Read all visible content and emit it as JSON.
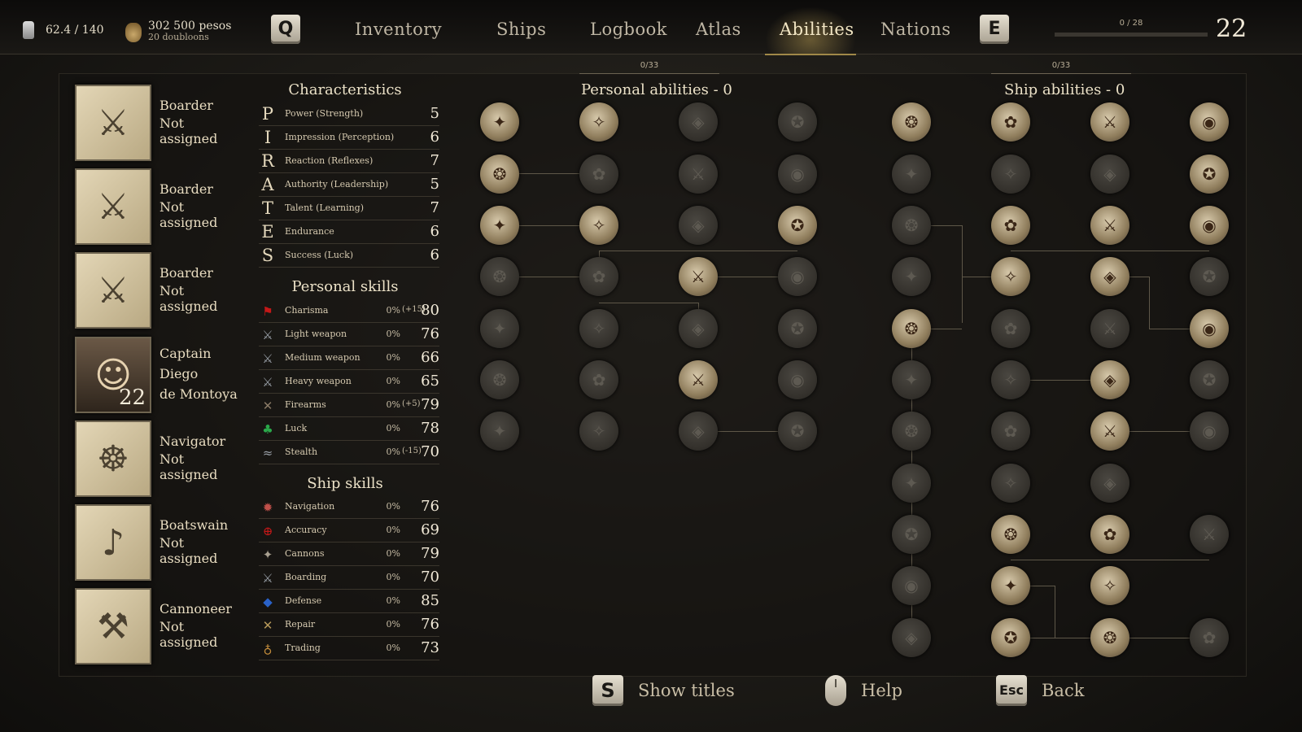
{
  "topbar": {
    "weight": "62.4 / 140",
    "pesos": "302 500 pesos",
    "doubloons": "20 doubloons",
    "key_left": "Q",
    "key_right": "E",
    "tabs": [
      "Inventory",
      "Ships",
      "Logbook",
      "Atlas",
      "Abilities",
      "Nations"
    ],
    "active_tab": "Abilities",
    "xp": "0 / 28",
    "xp_fraction": 0,
    "level": "22"
  },
  "officers": [
    {
      "role": "Boarder",
      "status": "Not assigned",
      "icon": "crossed-swords-icon"
    },
    {
      "role": "Boarder",
      "status": "Not assigned",
      "icon": "crossed-swords-icon"
    },
    {
      "role": "Boarder",
      "status": "Not assigned",
      "icon": "crossed-swords-icon"
    },
    {
      "role": "Captain",
      "name1": "Diego",
      "name2": "de Montoya",
      "level": "22",
      "icon": "captain-portrait"
    },
    {
      "role": "Navigator",
      "status": "Not assigned",
      "icon": "ship-wheel-icon"
    },
    {
      "role": "Boatswain",
      "status": "Not assigned",
      "icon": "bugle-icon"
    },
    {
      "role": "Cannoneer",
      "status": "Not assigned",
      "icon": "cannon-icon"
    }
  ],
  "characteristics": {
    "title": "Characteristics",
    "rows": [
      {
        "letter": "P",
        "label": "Power (Strength)",
        "value": "5"
      },
      {
        "letter": "I",
        "label": "Impression (Perception)",
        "value": "6"
      },
      {
        "letter": "R",
        "label": "Reaction (Reflexes)",
        "value": "7"
      },
      {
        "letter": "A",
        "label": "Authority (Leadership)",
        "value": "5"
      },
      {
        "letter": "T",
        "label": "Talent (Learning)",
        "value": "7"
      },
      {
        "letter": "E",
        "label": "Endurance",
        "value": "6"
      },
      {
        "letter": "S",
        "label": "Success (Luck)",
        "value": "6"
      }
    ]
  },
  "personal_skills": {
    "title": "Personal skills",
    "rows": [
      {
        "label": "Charisma",
        "pct": "0%",
        "mod": "(+15)",
        "value": "80",
        "icon": "flag-icon",
        "color": "#c41818"
      },
      {
        "label": "Light weapon",
        "pct": "0%",
        "mod": "",
        "value": "76",
        "icon": "light-weapon-icon",
        "color": "#9aa0a8"
      },
      {
        "label": "Medium weapon",
        "pct": "0%",
        "mod": "",
        "value": "66",
        "icon": "medium-weapon-icon",
        "color": "#9aa0a8"
      },
      {
        "label": "Heavy weapon",
        "pct": "0%",
        "mod": "",
        "value": "65",
        "icon": "heavy-weapon-icon",
        "color": "#9aa0a8"
      },
      {
        "label": "Firearms",
        "pct": "0%",
        "mod": "(+5)",
        "value": "79",
        "icon": "firearms-icon",
        "color": "#8a7a66"
      },
      {
        "label": "Luck",
        "pct": "0%",
        "mod": "",
        "value": "78",
        "icon": "clover-icon",
        "color": "#2aa84a"
      },
      {
        "label": "Stealth",
        "pct": "0%",
        "mod": "(-15)",
        "value": "70",
        "icon": "stealth-icon",
        "color": "#9aa0a8"
      }
    ]
  },
  "ship_skills": {
    "title": "Ship skills",
    "rows": [
      {
        "label": "Navigation",
        "pct": "0%",
        "value": "76",
        "icon": "compass-rose-icon",
        "color": "#c0504a"
      },
      {
        "label": "Accuracy",
        "pct": "0%",
        "value": "69",
        "icon": "crosshair-icon",
        "color": "#c41818"
      },
      {
        "label": "Cannons",
        "pct": "0%",
        "value": "79",
        "icon": "cannon-icon",
        "color": "#a8a090"
      },
      {
        "label": "Boarding",
        "pct": "0%",
        "value": "70",
        "icon": "boarding-icon",
        "color": "#9aa0a8"
      },
      {
        "label": "Defense",
        "pct": "0%",
        "value": "85",
        "icon": "shield-icon",
        "color": "#2a62c8"
      },
      {
        "label": "Repair",
        "pct": "0%",
        "value": "76",
        "icon": "hammer-icon",
        "color": "#b89a5a"
      },
      {
        "label": "Trading",
        "pct": "0%",
        "value": "73",
        "icon": "money-bag-icon",
        "color": "#c08a3a"
      }
    ]
  },
  "personal_abilities": {
    "title": "Personal abilities  -  0",
    "count": "0/33"
  },
  "ship_abilities": {
    "title": "Ship abilities  -  0",
    "count": "0/33"
  },
  "footer": {
    "show_titles_key": "S",
    "show_titles": "Show titles",
    "help": "Help",
    "back_key": "Esc",
    "back": "Back"
  }
}
